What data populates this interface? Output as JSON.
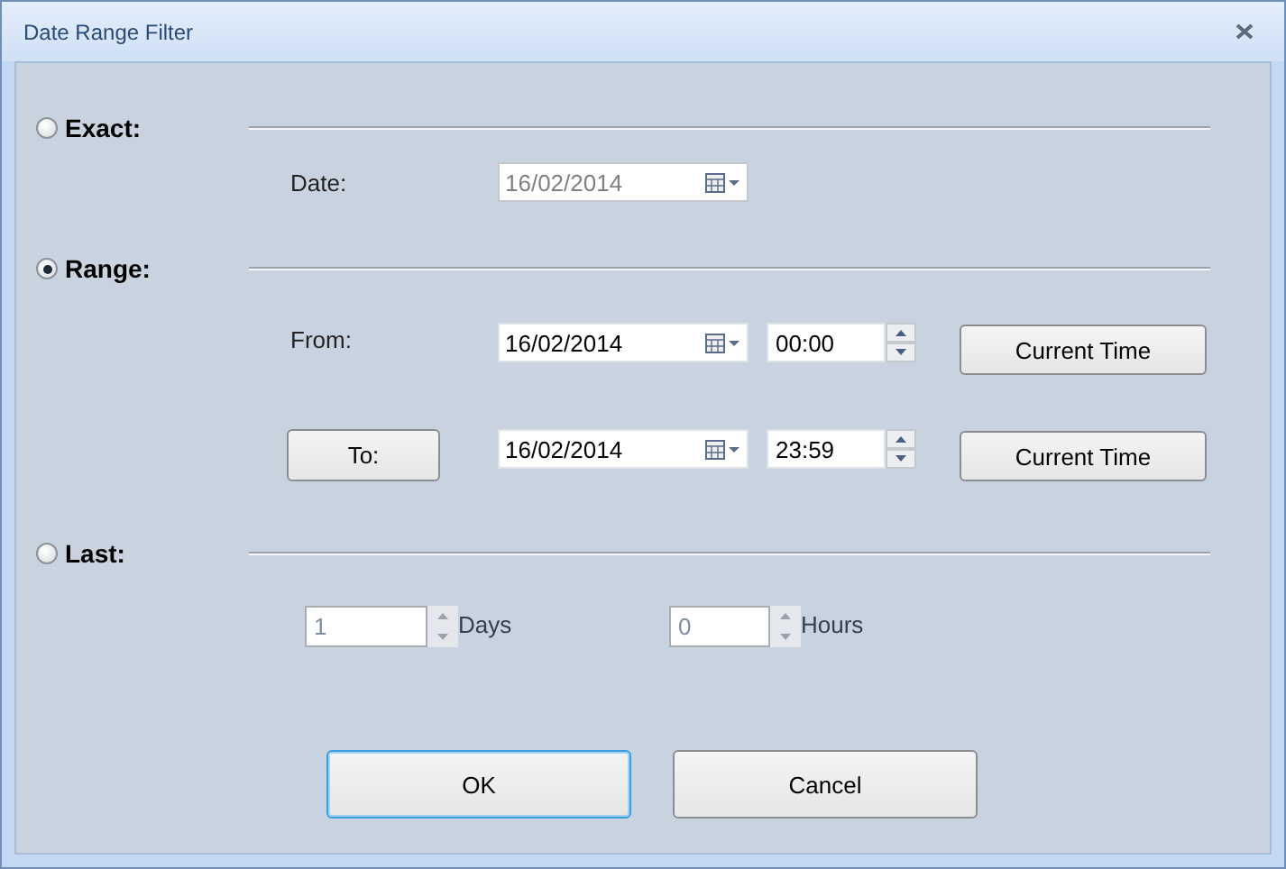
{
  "window": {
    "title": "Date Range Filter"
  },
  "exact": {
    "label": "Exact:",
    "selected": false,
    "date_label": "Date:",
    "date": {
      "value": "16/02/2014",
      "disabled": true
    }
  },
  "range": {
    "label": "Range:",
    "selected": true,
    "from_label": "From:",
    "from_date": {
      "value": "16/02/2014",
      "disabled": false
    },
    "from_time": {
      "value": "00:00",
      "disabled": false
    },
    "from_now_button": "Current Time",
    "to_button": "To:",
    "to_date": {
      "value": "16/02/2014",
      "disabled": false
    },
    "to_time": {
      "value": "23:59",
      "disabled": false
    },
    "to_now_button": "Current Time"
  },
  "last": {
    "label": "Last:",
    "selected": false,
    "days": {
      "value": "1",
      "disabled": true
    },
    "days_unit": "Days",
    "hours": {
      "value": "0",
      "disabled": true
    },
    "hours_unit": "Hours"
  },
  "buttons": [
    {
      "label": "OK",
      "default": true
    },
    {
      "label": "Cancel",
      "default": false
    }
  ]
}
